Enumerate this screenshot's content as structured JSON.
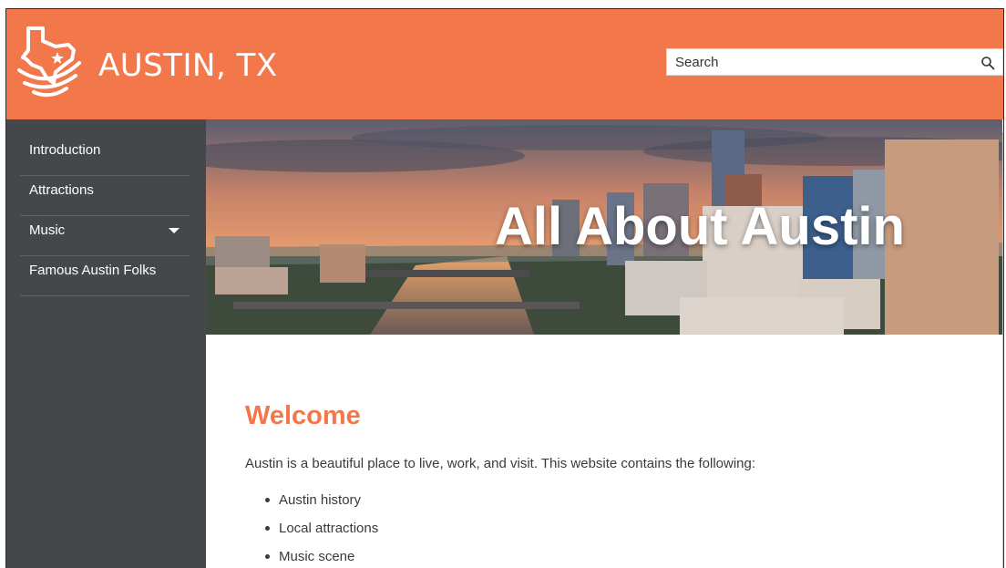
{
  "header": {
    "site_title": "AUSTIN, TX",
    "logo_icon": "texas-star-logo-icon",
    "accent_color": "#f2784b"
  },
  "search": {
    "placeholder": "Search",
    "icon": "search-icon"
  },
  "sidebar": {
    "background": "#45484a",
    "items": [
      {
        "label": "Introduction"
      },
      {
        "label": "Attractions"
      },
      {
        "label": "Music",
        "icon": "caret-down-icon"
      },
      {
        "label": "Famous Austin Folks"
      }
    ]
  },
  "hero": {
    "title": "All About Austin"
  },
  "main": {
    "heading": "Welcome",
    "intro": "Austin is a beautiful place to live, work, and visit. This website contains the following:",
    "list": [
      "Austin history",
      "Local attractions",
      "Music scene"
    ]
  }
}
